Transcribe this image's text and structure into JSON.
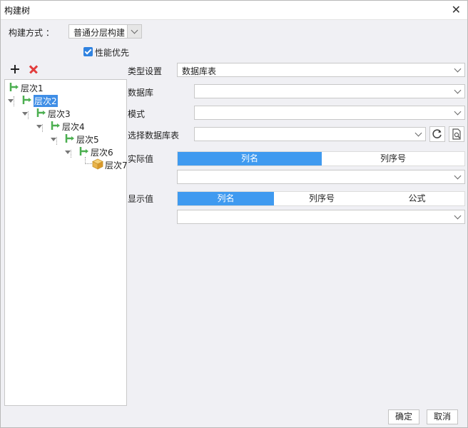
{
  "window": {
    "title": "构建树",
    "close_symbol": "✕"
  },
  "build_method": {
    "label": "构建方式 ：",
    "value": "普通分层构建"
  },
  "performance_first": {
    "label": "性能优先",
    "checked": true
  },
  "toolbar": {
    "add_icon": "plus-icon",
    "delete_icon": "delete-x-icon"
  },
  "tree": {
    "nodes": [
      {
        "label": "层次1",
        "depth": 0,
        "icon": "hierarchy-icon"
      },
      {
        "label": "层次2",
        "depth": 0,
        "icon": "hierarchy-icon",
        "selected": true
      },
      {
        "label": "层次3",
        "depth": 1,
        "icon": "hierarchy-icon"
      },
      {
        "label": "层次4",
        "depth": 2,
        "icon": "hierarchy-icon"
      },
      {
        "label": "层次5",
        "depth": 3,
        "icon": "hierarchy-icon"
      },
      {
        "label": "层次6",
        "depth": 4,
        "icon": "hierarchy-icon"
      },
      {
        "label": "层次7",
        "depth": 5,
        "icon": "cube-icon"
      }
    ]
  },
  "form": {
    "type_label": "类型设置",
    "type_value": "数据库表",
    "database_label": "数据库",
    "database_value": "",
    "schema_label": "模式",
    "schema_value": "",
    "table_label": "选择数据库表",
    "table_value": "",
    "actual_label": "实际值",
    "actual_tabs": [
      "列名",
      "列序号"
    ],
    "actual_value": "",
    "display_label": "显示值",
    "display_tabs": [
      "列名",
      "列序号",
      "公式"
    ],
    "display_value": ""
  },
  "buttons": {
    "ok": "确定",
    "cancel": "取消"
  },
  "colors": {
    "accent": "#3f9af0",
    "selection": "#3f8ee6",
    "delete": "#e23c3c",
    "tree_icon": "#4caf50"
  }
}
